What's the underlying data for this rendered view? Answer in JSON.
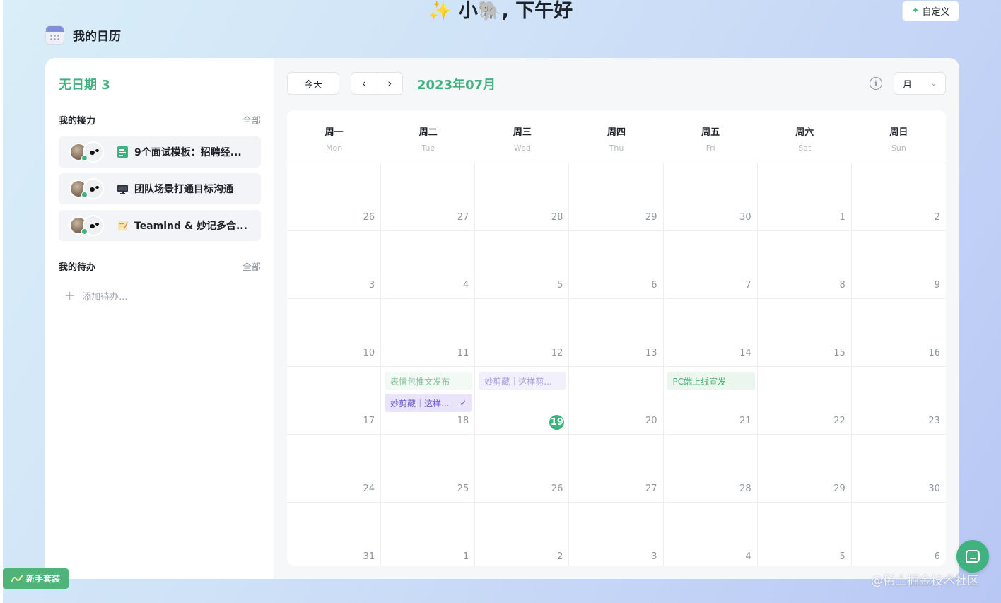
{
  "header": {
    "greeting": "小🐘, 下午好",
    "greeting_sparkle": "✨",
    "customize_label": "自定义",
    "app_title": "我的日历"
  },
  "sidebar": {
    "no_date_title": "无日期 3",
    "relay_section": {
      "label": "我的接力",
      "all": "全部"
    },
    "relay_items": [
      {
        "title": "9个面试模板：招聘经...",
        "icon": "sheet-icon"
      },
      {
        "title": "团队场景打通目标沟通",
        "icon": "monitor-icon"
      },
      {
        "title": "Teamind & 妙记多合...",
        "icon": "memo-icon"
      }
    ],
    "todo_section": {
      "label": "我的待办",
      "all": "全部"
    },
    "add_todo_placeholder": "添加待办..."
  },
  "toolbar": {
    "today_label": "今天",
    "prev_icon": "‹",
    "next_icon": "›",
    "month_label": "2023年07月",
    "info_icon": "i",
    "view_label": "月",
    "view_chevron": "⌄"
  },
  "calendar": {
    "weekdays": [
      {
        "cn": "周一",
        "en": "Mon"
      },
      {
        "cn": "周二",
        "en": "Tue"
      },
      {
        "cn": "周三",
        "en": "Wed"
      },
      {
        "cn": "周四",
        "en": "Thu"
      },
      {
        "cn": "周五",
        "en": "Fri"
      },
      {
        "cn": "周六",
        "en": "Sat"
      },
      {
        "cn": "周日",
        "en": "Sun"
      }
    ],
    "days": [
      "26",
      "27",
      "28",
      "29",
      "30",
      "1",
      "2",
      "3",
      "4",
      "5",
      "6",
      "7",
      "8",
      "9",
      "10",
      "11",
      "12",
      "13",
      "14",
      "15",
      "16",
      "17",
      "18",
      "19",
      "20",
      "21",
      "22",
      "23",
      "24",
      "25",
      "26",
      "27",
      "28",
      "29",
      "30",
      "31",
      "1",
      "2",
      "3",
      "4",
      "5",
      "6"
    ],
    "today": "19",
    "events": {
      "tue18_a": "表情包推文发布",
      "tue18_b": "妙剪藏｜这样...",
      "tue18_b_check": "✓",
      "wed19_a": "妙剪藏｜这样剪...",
      "fri21_a": "PC端上线宣发"
    }
  },
  "footer": {
    "onboarding_label": "新手套装",
    "watermark": "@稀土掘金技术社区"
  },
  "colors": {
    "accent": "#3fb27f",
    "purple": "#6b58c8"
  }
}
